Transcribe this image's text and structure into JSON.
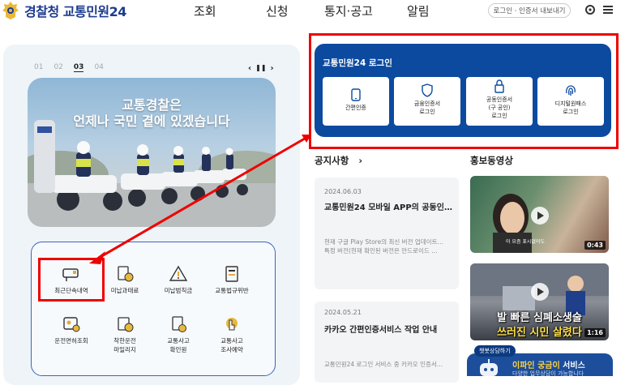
{
  "header": {
    "logo_org": "경찰청",
    "logo_service": "교통민원24",
    "nav": [
      "조회",
      "신청",
      "통지·공고",
      "알림"
    ],
    "cert_button": "로그인 · 인증서 내보내기",
    "icons": [
      "settings-gear-icon",
      "hamburger-menu-icon"
    ]
  },
  "slider": {
    "pages": [
      "01",
      "02",
      "03",
      "04"
    ],
    "active_page": "03",
    "controls": {
      "prev": "‹",
      "pause": "❚❚",
      "next": "›"
    },
    "banner_line1": "교통경찰은",
    "banner_line2": "언제나 국민 곁에 있겠습니다"
  },
  "services": [
    {
      "label": "최근단속내역",
      "icon": "camera-icon"
    },
    {
      "label": "미납과태료",
      "icon": "coins-icon"
    },
    {
      "label": "미납범칙금",
      "icon": "warning-icon"
    },
    {
      "label": "교통법규위반",
      "icon": "document-icon"
    },
    {
      "label": "운전면허조회",
      "icon": "id-card-icon"
    },
    {
      "label": "착한운전\n마일리지",
      "icon": "mileage-icon"
    },
    {
      "label": "교통사고\n확인원",
      "icon": "accident-doc-icon"
    },
    {
      "label": "교통사고\n조사예약",
      "icon": "hand-pointer-icon"
    }
  ],
  "login": {
    "title": "교통민원24 로그인",
    "buttons": [
      {
        "label": "간편인증",
        "icon": "mobile-icon"
      },
      {
        "label": "금융인증서\n로그인",
        "icon": "shield-icon"
      },
      {
        "label": "공동인증서\n(구 공인)\n로그인",
        "icon": "lock-icon"
      },
      {
        "label": "디지털원패스\n로그인",
        "icon": "fingerprint-icon"
      }
    ]
  },
  "notices": {
    "title": "공지사항",
    "more": "›",
    "items": [
      {
        "date": "2024.06.03",
        "title": "교통민원24 모바일 APP의 공동인…",
        "body": "현재 구글 Play Store의 최신 버전 업데이트… 특정 버전(현재 확인된 버전은 안드로이드 …"
      },
      {
        "date": "2024.05.21",
        "title": "카카오 간편인증서비스 작업 안내",
        "body": "교통민원24 로그인 서비스 중 카카오 인증서…"
      }
    ]
  },
  "promo": {
    "title": "홍보동영상",
    "videos": [
      {
        "duration": "0:43",
        "caption": "아 요즘 표시없어도"
      },
      {
        "duration": "1:16",
        "caption_line1": "발 빠른 심폐소생술",
        "caption_line2": "쓰러진 시민 살렸다"
      }
    ]
  },
  "chatbot": {
    "bubble": "챗봇상담하기",
    "title_highlight": "이파인 궁금이",
    "title_rest": " 서비스",
    "subtitle": "다양한 업무상담이 가능합니다"
  },
  "colors": {
    "brand_blue": "#1d3c8f",
    "login_bg": "#0c4aa0",
    "highlight_red": "#e00000"
  }
}
